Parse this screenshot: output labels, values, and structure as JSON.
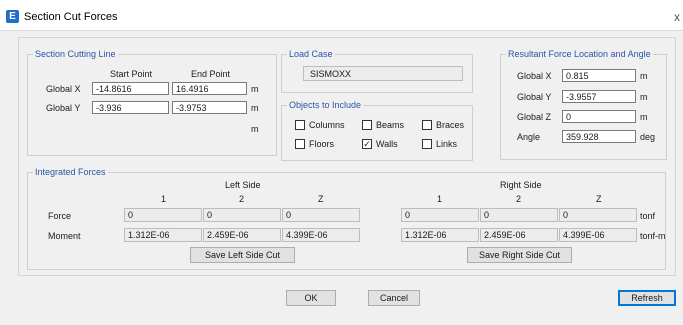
{
  "window": {
    "title": "Section Cut Forces",
    "app_icon": "E",
    "close_icon": "x"
  },
  "section_cutting_line": {
    "label": "Section Cutting Line",
    "start_header": "Start Point",
    "end_header": "End Point",
    "rows": [
      {
        "label": "Global  X",
        "start": "-14.8616",
        "end": "16.4916",
        "unit": "m"
      },
      {
        "label": "Global  Y",
        "start": "-3.936",
        "end": "-3.9753",
        "unit": "m"
      }
    ],
    "extra_unit": "m"
  },
  "load_case": {
    "label": "Load Case",
    "value": "SISMOXX"
  },
  "objects_to_include": {
    "label": "Objects to Include",
    "items": [
      {
        "label": "Columns",
        "checked": false
      },
      {
        "label": "Beams",
        "checked": false
      },
      {
        "label": "Braces",
        "checked": false
      },
      {
        "label": "Floors",
        "checked": false
      },
      {
        "label": "Walls",
        "checked": true
      },
      {
        "label": "Links",
        "checked": false
      }
    ],
    "check_mark": "✓"
  },
  "resultant": {
    "label": "Resultant Force Location and Angle",
    "rows": [
      {
        "label": "Global  X",
        "value": "0.815",
        "unit": "m"
      },
      {
        "label": "Global  Y",
        "value": "-3.9557",
        "unit": "m"
      },
      {
        "label": "Global  Z",
        "value": "0",
        "unit": "m"
      },
      {
        "label": "Angle",
        "value": "359.928",
        "unit": "deg"
      }
    ]
  },
  "integrated_forces": {
    "label": "Integrated Forces",
    "left_side": "Left Side",
    "right_side": "Right Side",
    "columns": [
      "1",
      "2",
      "Z"
    ],
    "rows": [
      {
        "label": "Force",
        "left": [
          "0",
          "0",
          "0"
        ],
        "right": [
          "0",
          "0",
          "0"
        ],
        "unit": "tonf"
      },
      {
        "label": "Moment",
        "left": [
          "1.312E-06",
          "2.459E-06",
          "4.399E-06"
        ],
        "right": [
          "1.312E-06",
          "2.459E-06",
          "4.399E-06"
        ],
        "unit": "tonf-m"
      }
    ],
    "save_left_label": "Save Left Side Cut",
    "save_right_label": "Save Right Side Cut"
  },
  "buttons": {
    "ok": "OK",
    "cancel": "Cancel",
    "refresh": "Refresh"
  }
}
